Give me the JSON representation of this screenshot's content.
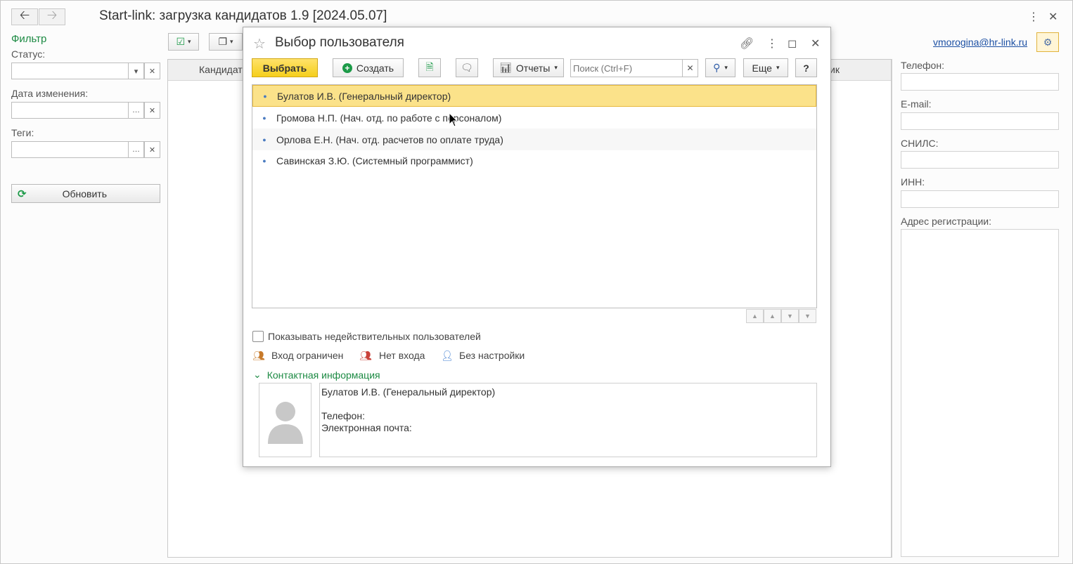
{
  "app": {
    "title": "Start-link: загрузка кандидатов 1.9 [2024.05.07]"
  },
  "filter": {
    "title": "Фильтр",
    "status_label": "Статус:",
    "date_label": "Дата изменения:",
    "tags_label": "Теги:",
    "refresh_label": "Обновить"
  },
  "main": {
    "columns": [
      "Кандидат",
      "ик"
    ]
  },
  "user": {
    "email": "vmorogina@hr-link.ru"
  },
  "right_panel": {
    "phone_label": "Телефон:",
    "email_label": "E-mail:",
    "snils_label": "СНИЛС:",
    "inn_label": "ИНН:",
    "address_label": "Адрес регистрации:"
  },
  "dialog": {
    "title": "Выбор пользователя",
    "select_label": "Выбрать",
    "create_label": "Создать",
    "reports_label": "Отчеты",
    "search_placeholder": "Поиск (Ctrl+F)",
    "more_label": "Еще",
    "help_label": "?",
    "users": [
      "Булатов И.В. (Генеральный директор)",
      "Громова Н.П. (Нач. отд. по работе с персоналом)",
      "Орлова Е.Н. (Нач. отд. расчетов по оплате труда)",
      "Савинская З.Ю. (Системный программист)"
    ],
    "show_invalid_label": "Показывать недействительных пользователей",
    "legend": {
      "restricted": "Вход ограничен",
      "no_login": "Нет входа",
      "no_setup": "Без настройки"
    },
    "contact_toggle": "Контактная информация",
    "contact": {
      "name": "Булатов И.В. (Генеральный директор)",
      "phone": "Телефон:",
      "email": "Электронная почта:"
    }
  },
  "colors": {
    "accent_green": "#1c8a43",
    "selected_row": "#fbe28a",
    "primary_button": "#f5cf1c",
    "link_blue": "#1b4fa3"
  }
}
